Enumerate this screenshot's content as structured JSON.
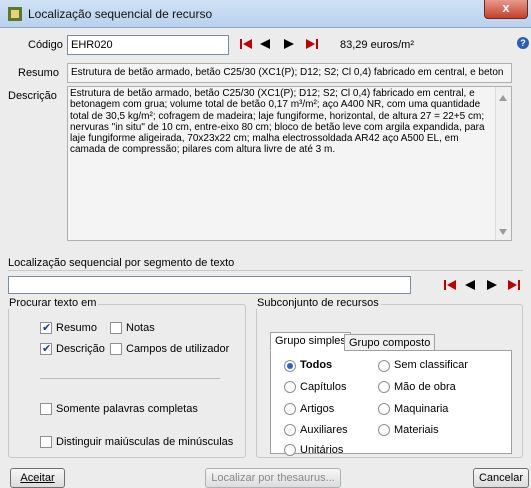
{
  "window": {
    "title": "Localização sequencial de recurso",
    "close_label": "x"
  },
  "codigo": {
    "label": "Código",
    "value": "EHR020",
    "price": "83,29 euros/m²"
  },
  "resumo": {
    "label": "Resumo",
    "value": "Estrutura de betão armado, betão C25/30 (XC1(P); D12; S2; Cl 0,4) fabricado em central, e beton"
  },
  "descricao": {
    "label": "Descrição",
    "value": "Estrutura de betão armado, betão C25/30 (XC1(P); D12; S2; Cl 0,4) fabricado em central, e betonagem com grua; volume total de betão 0,17 m³/m²; aço A400 NR, com uma quantidade total de 30,5 kg/m²; cofragem de madeira; laje fungiforme, horizontal, de altura 27 = 22+5 cm; nervuras \"in situ\" de 10 cm, entre-eixo 80 cm; bloco de betão leve com argila expandida, para laje fungiforme aligeirada, 70x23x22 cm; malha electrossoldada AR42 aço A500 EL, em camada de compressão; pilares com altura livre de até 3 m."
  },
  "search": {
    "label": "Localização sequencial por segmento de texto",
    "value": ""
  },
  "procurar": {
    "title": "Procurar texto em",
    "resumo": "Resumo",
    "notas": "Notas",
    "descricao": "Descrição",
    "campos": "Campos de utilizador",
    "palavras": "Somente palavras completas",
    "maiusculas": "Distinguir maiúsculas de minúsculas"
  },
  "subconjunto": {
    "title": "Subconjunto de recursos",
    "tab_simples": "Grupo simples",
    "tab_composto": "Grupo composto",
    "todos": "Todos",
    "capitulos": "Capítulos",
    "artigos": "Artigos",
    "auxiliares": "Auxiliares",
    "unitarios": "Unitários",
    "sem_classificar": "Sem classificar",
    "mao_de_obra": "Mão de obra",
    "maquinaria": "Maquinaria",
    "materiais": "Materiais"
  },
  "buttons": {
    "aceitar": "Aceitar",
    "thesaurus": "Localizar por thesaurus...",
    "cancelar": "Cancelar"
  },
  "help_label": "?",
  "colors": {
    "nav_red": "#c00000",
    "nav_black": "#000000",
    "radio_selected": "#2b61c9"
  }
}
